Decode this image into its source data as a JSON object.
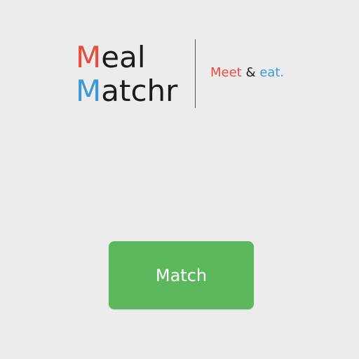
{
  "colors": {
    "background": "#ececec",
    "accent_red": "#e74c3c",
    "accent_blue": "#3a9ad9",
    "text_dark": "#1a1a1a",
    "button_green": "#5cb85c",
    "divider": "#555555"
  },
  "logo": {
    "line1_initial": "M",
    "line1_rest": "eal",
    "line2_initial": "M",
    "line2_rest": "atchr"
  },
  "tagline": {
    "word1": "Meet",
    "connector": " & ",
    "word2": "eat."
  },
  "actions": {
    "match_label": "Match"
  }
}
